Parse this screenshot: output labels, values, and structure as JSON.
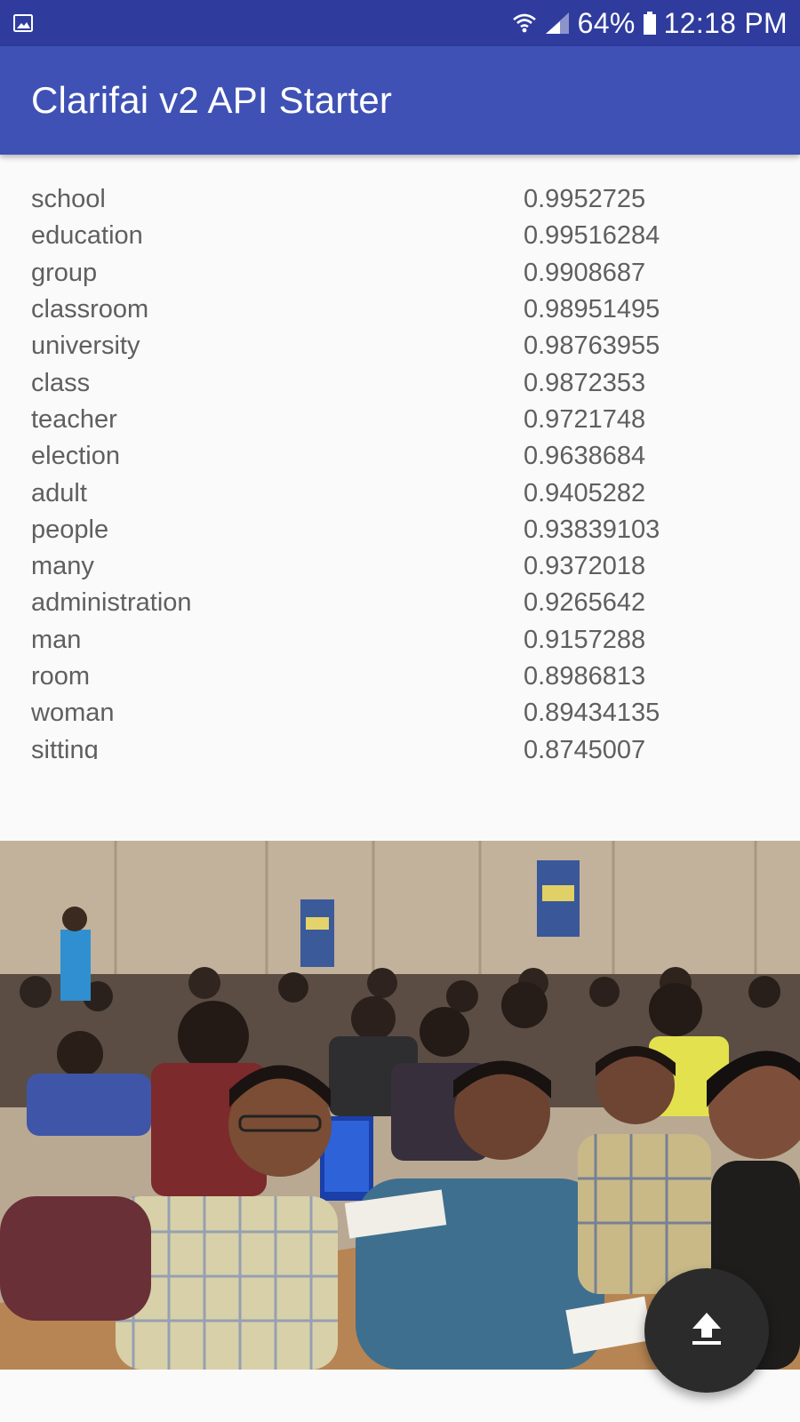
{
  "status_bar": {
    "left_icon": "gallery-icon",
    "wifi_icon": "wifi-icon",
    "signal_icon": "signal-icon",
    "battery_percent": "64%",
    "battery_icon": "battery-icon",
    "time": "12:18 PM",
    "background_color": "#2f3c9e"
  },
  "app_bar": {
    "title": "Clarifai v2 API Starter",
    "background_color": "#3f51b5"
  },
  "results": [
    {
      "label": "school",
      "score": "0.9952725"
    },
    {
      "label": "education",
      "score": "0.99516284"
    },
    {
      "label": "group",
      "score": "0.9908687"
    },
    {
      "label": "classroom",
      "score": "0.98951495"
    },
    {
      "label": "university",
      "score": "0.98763955"
    },
    {
      "label": "class",
      "score": "0.9872353"
    },
    {
      "label": "teacher",
      "score": "0.9721748"
    },
    {
      "label": "election",
      "score": "0.9638684"
    },
    {
      "label": "adult",
      "score": "0.9405282"
    },
    {
      "label": "people",
      "score": "0.93839103"
    },
    {
      "label": "many",
      "score": "0.9372018"
    },
    {
      "label": "administration",
      "score": "0.9265642"
    },
    {
      "label": "man",
      "score": "0.9157288"
    },
    {
      "label": "room",
      "score": "0.8986813"
    },
    {
      "label": "woman",
      "score": "0.89434135"
    },
    {
      "label": "sitting",
      "score": "0.8745007"
    }
  ],
  "image": {
    "alt_icon": "classroom-photo"
  },
  "fab": {
    "icon": "upload-icon",
    "background_color": "#2b2b2b"
  }
}
